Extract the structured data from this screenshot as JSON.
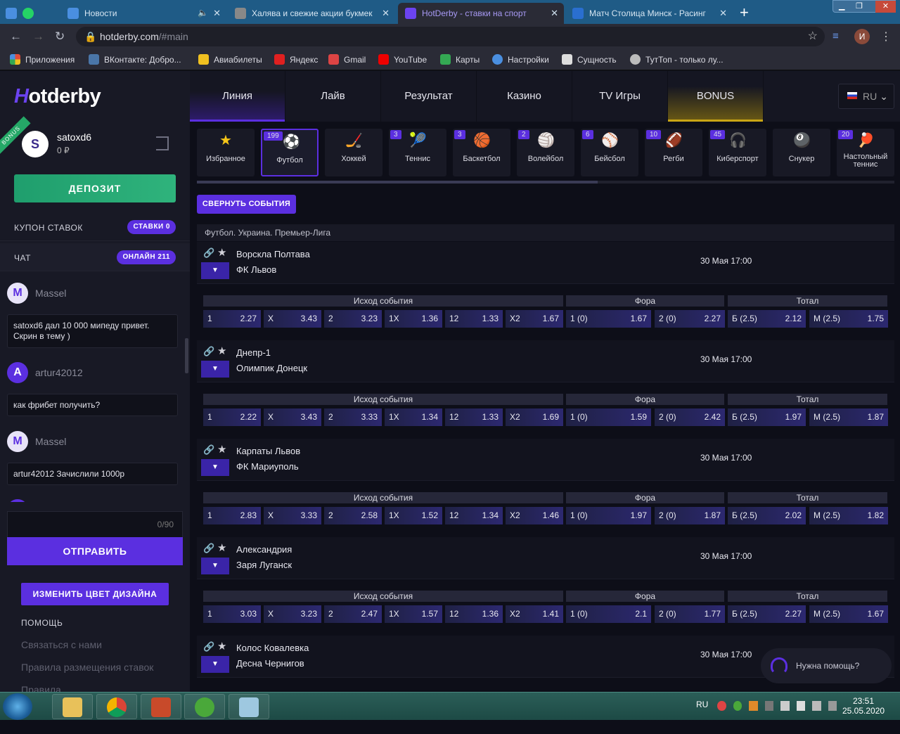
{
  "browser": {
    "tabs": [
      {
        "label": "Новости",
        "fav": "#4a8fe0"
      },
      {
        "label": "Халява и свежие акции букмек",
        "fav": "#888"
      },
      {
        "label": "HotDerby - ставки на спорт",
        "fav": "#6b43f0"
      },
      {
        "label": "Матч Столица Минск - Расинг",
        "fav": "#2a6fd0"
      }
    ],
    "url_host": "hotderby.com",
    "url_path": "/#main",
    "profile_letter": "И",
    "bookmarks": [
      {
        "label": "Приложения",
        "color": "#e04b3a"
      },
      {
        "label": "ВКонтакте: Добро...",
        "color": "#4a76a8"
      },
      {
        "label": "Авиабилеты",
        "color": "#f0c020"
      },
      {
        "label": "Яндекс",
        "color": "#e02020"
      },
      {
        "label": "Gmail",
        "color": "#d44"
      },
      {
        "label": "YouTube",
        "color": "#e00"
      },
      {
        "label": "Карты",
        "color": "#34a853"
      },
      {
        "label": "Настройки",
        "color": "#4a8fe0"
      },
      {
        "label": "Сущность",
        "color": "#ddd"
      },
      {
        "label": "ТутТоп - только лу...",
        "color": "#bbb"
      }
    ]
  },
  "sidebar": {
    "logo_h": "H",
    "logo_rest": "otderby",
    "bonus_ribbon": "BONUS",
    "user": {
      "avatar": "S",
      "name": "satoxd6",
      "balance": "0 ₽"
    },
    "deposit": "ДЕПОЗИТ",
    "coupon": {
      "label": "КУПОН СТАВОК",
      "pill": "СТАВКИ 0"
    },
    "chat": {
      "label": "ЧАТ",
      "pill": "ОНЛАЙН 211"
    },
    "messages": [
      {
        "user": "Massel",
        "avatar": "M",
        "avatar_bg": "#e8e4f8",
        "avatar_fg": "#5b2fe0",
        "text": "satoxd6 дал 10 000 мипеду привет. Скрин в тему )"
      },
      {
        "user": "artur42012",
        "avatar": "A",
        "avatar_bg": "#5b2fe0",
        "avatar_fg": "#fff",
        "text": "как фрибет получить?"
      },
      {
        "user": "Massel",
        "avatar": "M",
        "avatar_bg": "#e8e4f8",
        "avatar_fg": "#5b2fe0",
        "text": "artur42012 Зачислили 1000р"
      }
    ],
    "char_counter": "0/90",
    "send": "ОТПРАВИТЬ",
    "design": "ИЗМЕНИТЬ ЦВЕТ ДИЗАЙНА",
    "help_title": "ПОМОЩЬ",
    "links": [
      "Связаться с нами",
      "Правила размещения ставок",
      "Правила"
    ]
  },
  "nav": {
    "tabs": [
      "Линия",
      "Лайв",
      "Результат",
      "Казино",
      "TV Игры",
      "BONUS"
    ],
    "lang": "RU"
  },
  "sports": [
    {
      "name": "Избранное",
      "count": "",
      "icon": "★",
      "color": "#f5c518"
    },
    {
      "name": "Футбол",
      "count": "199",
      "icon": "⚽",
      "color": "#fff"
    },
    {
      "name": "Хоккей",
      "count": "",
      "icon": "🏒",
      "color": "#ccc"
    },
    {
      "name": "Теннис",
      "count": "3",
      "icon": "🎾",
      "color": "#3c8fd6"
    },
    {
      "name": "Баскетбол",
      "count": "3",
      "icon": "🏀",
      "color": "#e07a2e"
    },
    {
      "name": "Волейбол",
      "count": "2",
      "icon": "🏐",
      "color": "#eee"
    },
    {
      "name": "Бейсбол",
      "count": "6",
      "icon": "⚾",
      "color": "#eee"
    },
    {
      "name": "Регби",
      "count": "10",
      "icon": "🏈",
      "color": "#a0522d"
    },
    {
      "name": "Киберспорт",
      "count": "45",
      "icon": "🎧",
      "color": "#ddd"
    },
    {
      "name": "Снукер",
      "count": "",
      "icon": "🎱",
      "color": "#222"
    },
    {
      "name": "Настольный теннис",
      "count": "20",
      "icon": "🏓",
      "color": "#e03030"
    }
  ],
  "collapse_events": "СВЕРНУТЬ СОБЫТИЯ",
  "league": "Футбол. Украина. Премьер-Лига",
  "market_labels": {
    "outcome": "Исход события",
    "handicap": "Фора",
    "total": "Тотал"
  },
  "matches": [
    {
      "team1": "Ворскла Полтава",
      "team2": "ФК Львов",
      "date": "30 Мая 17:00",
      "odds": [
        [
          "1",
          "2.27"
        ],
        [
          "X",
          "3.43"
        ],
        [
          "2",
          "3.23"
        ],
        [
          "1X",
          "1.36"
        ],
        [
          "12",
          "1.33"
        ],
        [
          "X2",
          "1.67"
        ],
        [
          "1 (0)",
          "1.67"
        ],
        [
          "2 (0)",
          "2.27"
        ],
        [
          "Б (2.5)",
          "2.12"
        ],
        [
          "М (2.5)",
          "1.75"
        ]
      ]
    },
    {
      "team1": "Днепр-1",
      "team2": "Олимпик Донецк",
      "date": "30 Мая 17:00",
      "odds": [
        [
          "1",
          "2.22"
        ],
        [
          "X",
          "3.43"
        ],
        [
          "2",
          "3.33"
        ],
        [
          "1X",
          "1.34"
        ],
        [
          "12",
          "1.33"
        ],
        [
          "X2",
          "1.69"
        ],
        [
          "1 (0)",
          "1.59"
        ],
        [
          "2 (0)",
          "2.42"
        ],
        [
          "Б (2.5)",
          "1.97"
        ],
        [
          "М (2.5)",
          "1.87"
        ]
      ]
    },
    {
      "team1": "Карпаты Львов",
      "team2": "ФК Мариуполь",
      "date": "30 Мая 17:00",
      "odds": [
        [
          "1",
          "2.83"
        ],
        [
          "X",
          "3.33"
        ],
        [
          "2",
          "2.58"
        ],
        [
          "1X",
          "1.52"
        ],
        [
          "12",
          "1.34"
        ],
        [
          "X2",
          "1.46"
        ],
        [
          "1 (0)",
          "1.97"
        ],
        [
          "2 (0)",
          "1.87"
        ],
        [
          "Б (2.5)",
          "2.02"
        ],
        [
          "М (2.5)",
          "1.82"
        ]
      ]
    },
    {
      "team1": "Александрия",
      "team2": "Заря Луганск",
      "date": "30 Мая 17:00",
      "odds": [
        [
          "1",
          "3.03"
        ],
        [
          "X",
          "3.23"
        ],
        [
          "2",
          "2.47"
        ],
        [
          "1X",
          "1.57"
        ],
        [
          "12",
          "1.36"
        ],
        [
          "X2",
          "1.41"
        ],
        [
          "1 (0)",
          "2.1"
        ],
        [
          "2 (0)",
          "1.77"
        ],
        [
          "Б (2.5)",
          "2.27"
        ],
        [
          "М (2.5)",
          "1.67"
        ]
      ]
    },
    {
      "team1": "Колос Ковалевка",
      "team2": "Десна Чернигов",
      "date": "30 Мая 17:00",
      "odds": []
    }
  ],
  "help_widget": "Нужна помощь?",
  "taskbar": {
    "lang": "RU",
    "time": "23:51",
    "date": "25.05.2020"
  }
}
